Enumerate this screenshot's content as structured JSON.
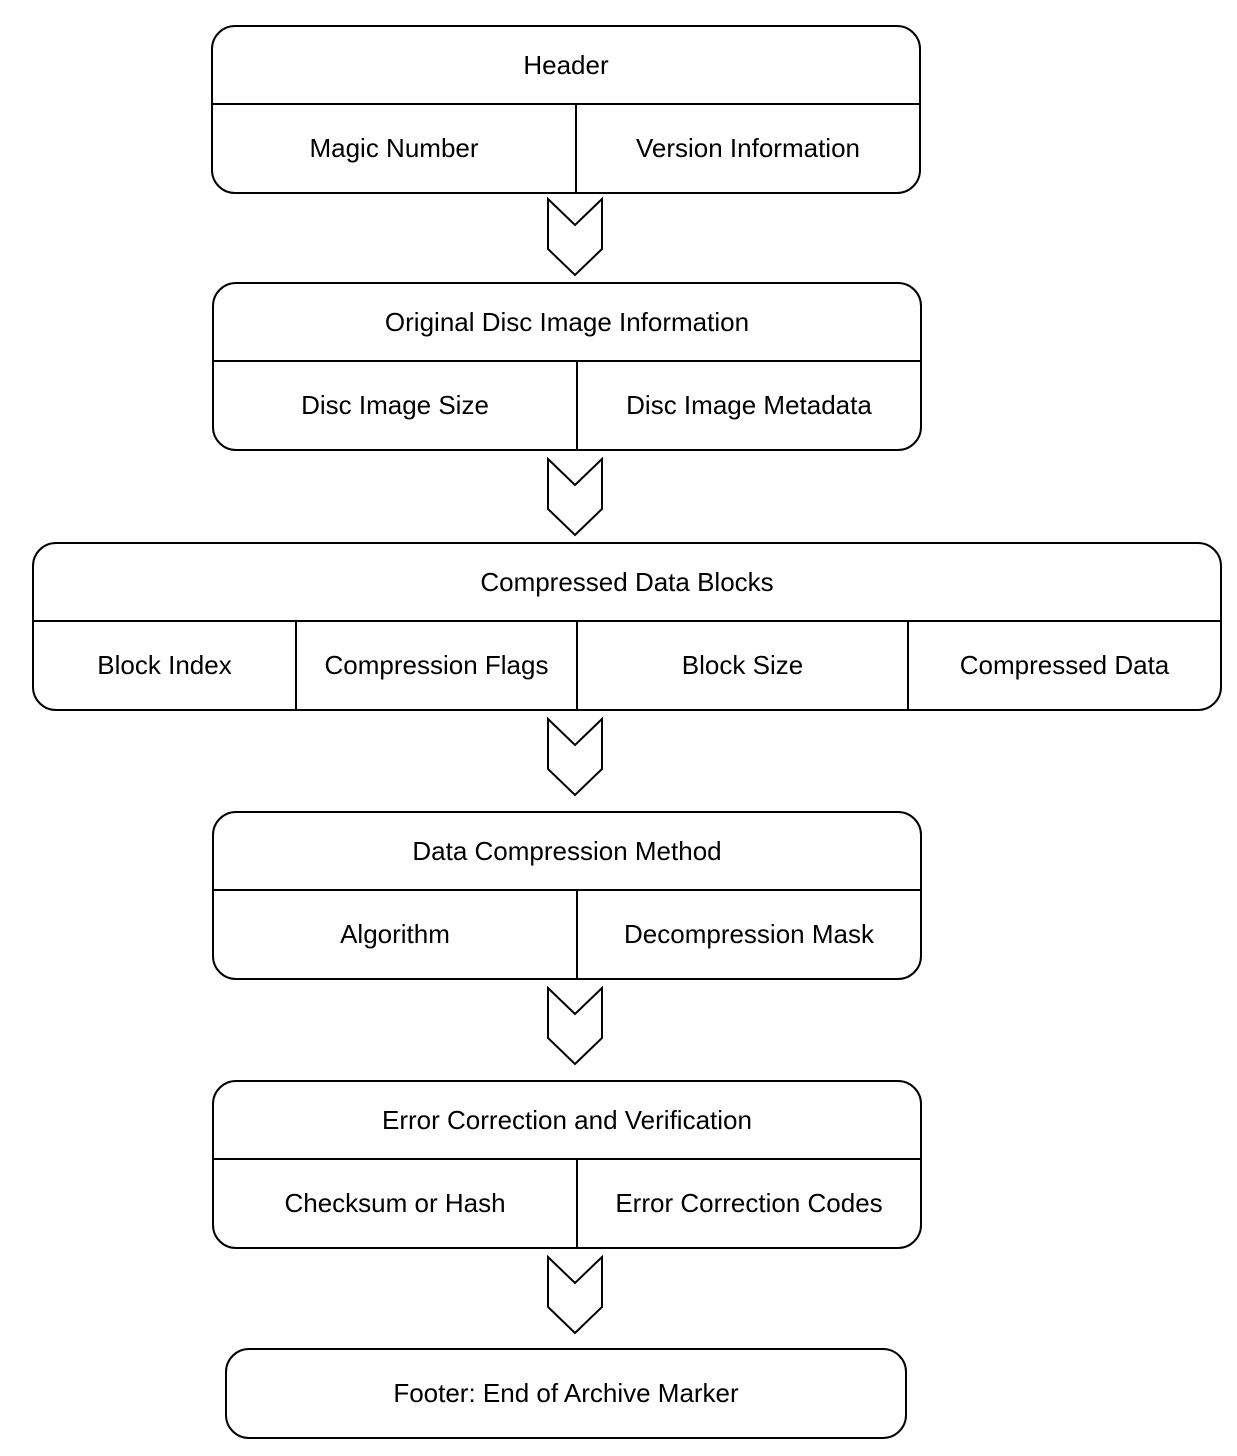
{
  "sections": [
    {
      "title": "Header",
      "fields": [
        "Magic Number",
        "Version Information"
      ]
    },
    {
      "title": "Original Disc Image Information",
      "fields": [
        "Disc Image Size",
        "Disc Image Metadata"
      ]
    },
    {
      "title": "Compressed Data Blocks",
      "fields": [
        "Block Index",
        "Compression Flags",
        "Block Size",
        "Compressed Data"
      ]
    },
    {
      "title": "Data Compression Method",
      "fields": [
        "Algorithm",
        "Decompression Mask"
      ]
    },
    {
      "title": "Error Correction and Verification",
      "fields": [
        "Checksum or Hash",
        "Error Correction Codes"
      ]
    }
  ],
  "footer": {
    "title": "Footer: End of Archive Marker"
  },
  "connector_icon": "chevron-down-arrow"
}
